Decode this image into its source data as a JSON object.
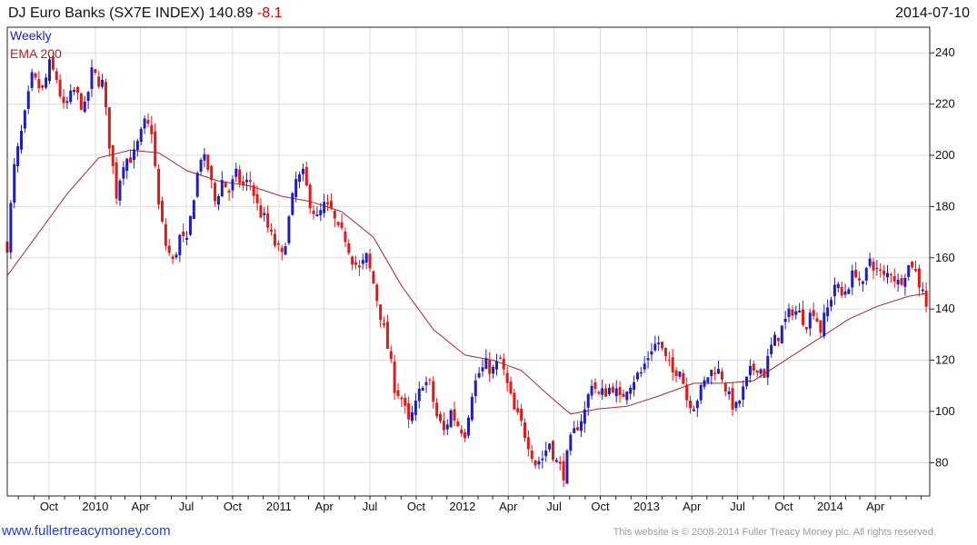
{
  "header": {
    "title": "DJ Euro Banks (SX7E INDEX) 140.89",
    "change": "-8.1",
    "date": "2014-07-10"
  },
  "footer": {
    "link": "www.fullertreacymoney.com",
    "copyright": "This website is © 2008-2014 Fuller Treacy Money plc. All rights reserved."
  },
  "colors": {
    "up": "#1f1fb4",
    "down": "#e01818",
    "ema": "#a52a2a",
    "grid": "#dcdcdc",
    "frame": "#222222"
  },
  "chart_data": {
    "type": "candlestick",
    "period": "Weekly",
    "indicator": "EMA 200",
    "x_ticks": [
      "Oct",
      "2010",
      "Apr",
      "Jul",
      "Oct",
      "2011",
      "Apr",
      "Jul",
      "Oct",
      "2012",
      "Apr",
      "Jul",
      "Oct",
      "2013",
      "Apr",
      "Jul",
      "Oct",
      "2014",
      "Apr"
    ],
    "y_ticks": [
      80,
      100,
      120,
      140,
      160,
      180,
      200,
      220,
      240
    ],
    "y_range": [
      67,
      250
    ],
    "x_range": [
      "2009-07-10",
      "2014-07-18"
    ],
    "grid": true,
    "legend_position": "top-left",
    "last_value": 140.89,
    "price_path": [
      [
        "2009-07-10",
        165
      ],
      [
        "2009-07-24",
        195
      ],
      [
        "2009-08-14",
        215
      ],
      [
        "2009-08-28",
        230
      ],
      [
        "2009-09-18",
        225
      ],
      [
        "2009-10-02",
        235
      ],
      [
        "2009-10-16",
        230
      ],
      [
        "2009-10-30",
        218
      ],
      [
        "2009-11-20",
        225
      ],
      [
        "2009-12-11",
        218
      ],
      [
        "2009-12-25",
        232
      ],
      [
        "2010-01-15",
        228
      ],
      [
        "2010-01-29",
        205
      ],
      [
        "2010-02-12",
        185
      ],
      [
        "2010-02-26",
        198
      ],
      [
        "2010-03-19",
        200
      ],
      [
        "2010-04-09",
        212
      ],
      [
        "2010-04-23",
        210
      ],
      [
        "2010-05-07",
        180
      ],
      [
        "2010-05-21",
        165
      ],
      [
        "2010-06-04",
        158
      ],
      [
        "2010-06-18",
        168
      ],
      [
        "2010-07-02",
        165
      ],
      [
        "2010-07-16",
        185
      ],
      [
        "2010-07-30",
        200
      ],
      [
        "2010-08-13",
        195
      ],
      [
        "2010-08-27",
        182
      ],
      [
        "2010-09-10",
        190
      ],
      [
        "2010-09-24",
        186
      ],
      [
        "2010-10-08",
        192
      ],
      [
        "2010-10-22",
        188
      ],
      [
        "2010-11-05",
        190
      ],
      [
        "2010-11-19",
        180
      ],
      [
        "2010-12-03",
        175
      ],
      [
        "2010-12-17",
        168
      ],
      [
        "2011-01-07",
        160
      ],
      [
        "2011-01-21",
        175
      ],
      [
        "2011-02-04",
        190
      ],
      [
        "2011-02-18",
        192
      ],
      [
        "2011-03-04",
        182
      ],
      [
        "2011-03-18",
        175
      ],
      [
        "2011-04-01",
        180
      ],
      [
        "2011-04-15",
        178
      ],
      [
        "2011-04-29",
        170
      ],
      [
        "2011-05-13",
        168
      ],
      [
        "2011-05-27",
        160
      ],
      [
        "2011-06-10",
        155
      ],
      [
        "2011-06-24",
        160
      ],
      [
        "2011-07-08",
        150
      ],
      [
        "2011-07-22",
        138
      ],
      [
        "2011-08-05",
        125
      ],
      [
        "2011-08-19",
        110
      ],
      [
        "2011-09-02",
        105
      ],
      [
        "2011-09-16",
        95
      ],
      [
        "2011-09-30",
        102
      ],
      [
        "2011-10-14",
        112
      ],
      [
        "2011-10-28",
        110
      ],
      [
        "2011-11-11",
        98
      ],
      [
        "2011-11-25",
        92
      ],
      [
        "2011-12-09",
        100
      ],
      [
        "2011-12-23",
        95
      ],
      [
        "2012-01-06",
        92
      ],
      [
        "2012-01-20",
        108
      ],
      [
        "2012-02-03",
        115
      ],
      [
        "2012-02-17",
        118
      ],
      [
        "2012-03-02",
        116
      ],
      [
        "2012-03-16",
        120
      ],
      [
        "2012-03-30",
        110
      ],
      [
        "2012-04-13",
        100
      ],
      [
        "2012-04-27",
        95
      ],
      [
        "2012-05-11",
        88
      ],
      [
        "2012-05-25",
        80
      ],
      [
        "2012-06-08",
        82
      ],
      [
        "2012-06-22",
        88
      ],
      [
        "2012-07-06",
        80
      ],
      [
        "2012-07-20",
        76
      ],
      [
        "2012-08-03",
        88
      ],
      [
        "2012-08-17",
        95
      ],
      [
        "2012-08-31",
        100
      ],
      [
        "2012-09-14",
        112
      ],
      [
        "2012-09-28",
        106
      ],
      [
        "2012-10-12",
        108
      ],
      [
        "2012-10-26",
        110
      ],
      [
        "2012-11-09",
        104
      ],
      [
        "2012-11-23",
        110
      ],
      [
        "2012-12-07",
        113
      ],
      [
        "2012-12-21",
        115
      ],
      [
        "2013-01-11",
        125
      ],
      [
        "2013-01-25",
        127
      ],
      [
        "2013-02-08",
        120
      ],
      [
        "2013-02-22",
        115
      ],
      [
        "2013-03-08",
        118
      ],
      [
        "2013-03-22",
        105
      ],
      [
        "2013-04-05",
        103
      ],
      [
        "2013-04-19",
        108
      ],
      [
        "2013-05-03",
        114
      ],
      [
        "2013-05-17",
        117
      ],
      [
        "2013-05-31",
        114
      ],
      [
        "2013-06-14",
        105
      ],
      [
        "2013-06-28",
        101
      ],
      [
        "2013-07-12",
        108
      ],
      [
        "2013-07-26",
        115
      ],
      [
        "2013-08-09",
        118
      ],
      [
        "2013-08-23",
        115
      ],
      [
        "2013-09-06",
        125
      ],
      [
        "2013-09-20",
        130
      ],
      [
        "2013-10-04",
        135
      ],
      [
        "2013-10-18",
        140
      ],
      [
        "2013-11-01",
        138
      ],
      [
        "2013-11-15",
        135
      ],
      [
        "2013-11-29",
        140
      ],
      [
        "2013-12-13",
        132
      ],
      [
        "2013-12-27",
        140
      ],
      [
        "2014-01-10",
        150
      ],
      [
        "2014-01-24",
        145
      ],
      [
        "2014-02-07",
        150
      ],
      [
        "2014-02-21",
        155
      ],
      [
        "2014-03-07",
        148
      ],
      [
        "2014-03-21",
        160
      ],
      [
        "2014-04-04",
        155
      ],
      [
        "2014-04-18",
        152
      ],
      [
        "2014-05-02",
        155
      ],
      [
        "2014-05-16",
        150
      ],
      [
        "2014-05-30",
        155
      ],
      [
        "2014-06-13",
        158
      ],
      [
        "2014-06-27",
        150
      ],
      [
        "2014-07-04",
        149
      ],
      [
        "2014-07-11",
        140.89
      ]
    ],
    "ema_path": [
      [
        "2009-07-10",
        153
      ],
      [
        "2009-09-04",
        168
      ],
      [
        "2009-11-06",
        185
      ],
      [
        "2010-01-08",
        199
      ],
      [
        "2010-03-12",
        202
      ],
      [
        "2010-05-07",
        201
      ],
      [
        "2010-07-02",
        194
      ],
      [
        "2010-09-03",
        190
      ],
      [
        "2010-11-05",
        188
      ],
      [
        "2011-01-07",
        184
      ],
      [
        "2011-03-04",
        182
      ],
      [
        "2011-05-06",
        178
      ],
      [
        "2011-07-08",
        168
      ],
      [
        "2011-09-02",
        149
      ],
      [
        "2011-11-04",
        132
      ],
      [
        "2012-01-06",
        122
      ],
      [
        "2012-03-02",
        120
      ],
      [
        "2012-04-27",
        116
      ],
      [
        "2012-06-22",
        106
      ],
      [
        "2012-08-03",
        99
      ],
      [
        "2012-09-28",
        101
      ],
      [
        "2012-11-23",
        102
      ],
      [
        "2013-01-25",
        106
      ],
      [
        "2013-04-05",
        111
      ],
      [
        "2013-06-07",
        111
      ],
      [
        "2013-08-02",
        112
      ],
      [
        "2013-10-04",
        120
      ],
      [
        "2013-12-06",
        128
      ],
      [
        "2014-02-07",
        136
      ],
      [
        "2014-04-04",
        141
      ],
      [
        "2014-06-06",
        145
      ],
      [
        "2014-07-11",
        146
      ]
    ]
  }
}
